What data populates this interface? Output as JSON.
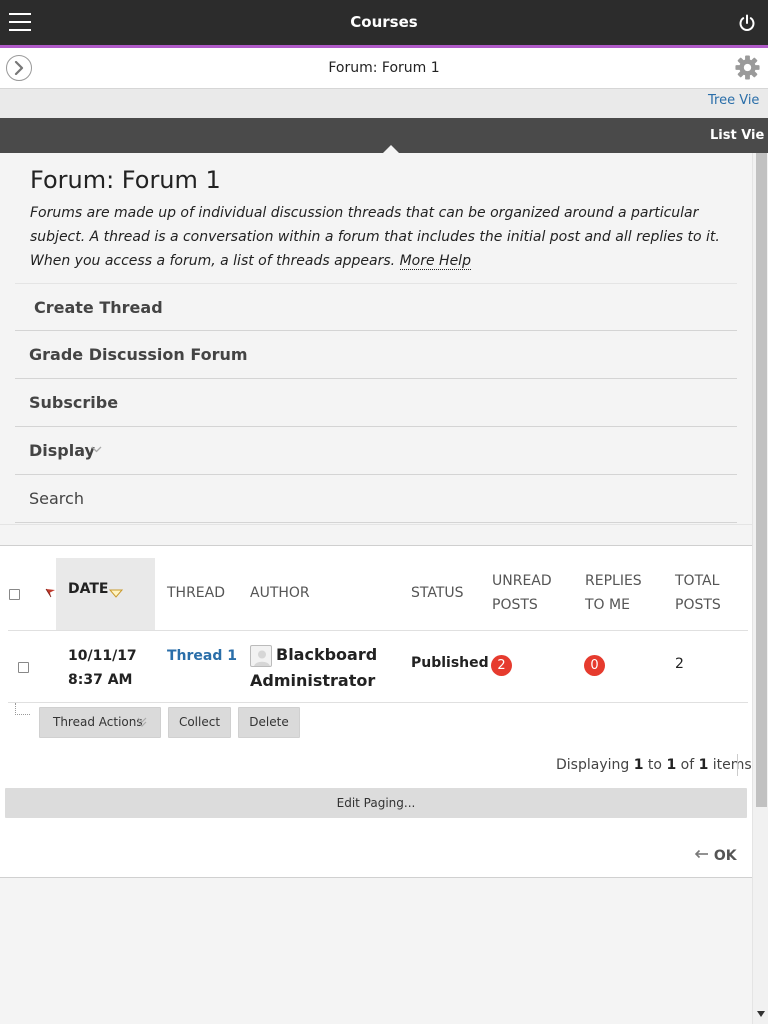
{
  "header": {
    "title": "Courses"
  },
  "subheader": {
    "title": "Forum: Forum 1"
  },
  "views": {
    "tree_view": "Tree Vie",
    "list_view": "List Vie"
  },
  "forum": {
    "heading": "Forum: Forum 1",
    "description": "Forums are made up of individual discussion threads that can be organized around a particular subject. A thread is a conversation within a forum that includes the initial post and all replies to it. When you access a forum, a list of threads appears.",
    "more_help": "More Help"
  },
  "actions": {
    "create_thread": "Create Thread",
    "grade_discussion_forum": "Grade Discussion Forum",
    "subscribe": "Subscribe",
    "display": "Display",
    "search": "Search"
  },
  "table": {
    "headers": {
      "date": "DATE",
      "thread": "THREAD",
      "author": "AUTHOR",
      "status": "STATUS",
      "unread_posts_1": "UNREAD",
      "unread_posts_2": "POSTS",
      "replies_to_me_1": "REPLIES",
      "replies_to_me_2": "TO ME",
      "total_posts_1": "TOTAL",
      "total_posts_2": "POSTS"
    },
    "rows": [
      {
        "date_line1": "10/11/17",
        "date_line2": "8:37 AM",
        "thread": "Thread 1",
        "author": "Blackboard Administrator",
        "status": "Published",
        "unread_posts": "2",
        "replies_to_me": "0",
        "total_posts": "2"
      }
    ]
  },
  "row_actions": {
    "thread_actions": "Thread Actions",
    "collect": "Collect",
    "delete": "Delete"
  },
  "pager": {
    "prefix": "Displaying",
    "from": "1",
    "to_word": "to",
    "to": "1",
    "of_word": "of",
    "total": "1",
    "suffix": "items",
    "edit_paging": "Edit Paging..."
  },
  "footer": {
    "ok": "OK"
  },
  "colors": {
    "topbar": "#2c2c2c",
    "accent": "#b05ac8",
    "link": "#2a6ea9",
    "badge": "#e63b2e"
  }
}
